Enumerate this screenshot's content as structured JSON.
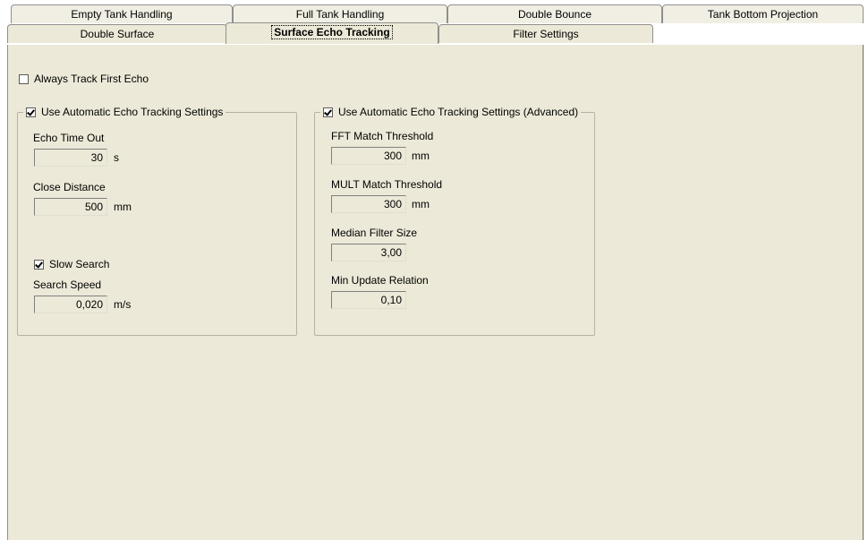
{
  "tabs": {
    "back_row": [
      "Empty Tank Handling",
      "Full Tank Handling",
      "Double Bounce",
      "Tank Bottom Projection"
    ],
    "front_row": [
      "Double Surface",
      "Surface Echo Tracking",
      "Filter Settings"
    ],
    "active": "Surface Echo Tracking"
  },
  "always_track_first_echo": {
    "label": "Always Track First Echo",
    "checked": false
  },
  "basic": {
    "legend": "Use Automatic Echo Tracking Settings",
    "checked": true,
    "echo_time_out": {
      "label": "Echo Time Out",
      "value": "30",
      "unit": "s"
    },
    "close_distance": {
      "label": "Close Distance",
      "value": "500",
      "unit": "mm"
    },
    "slow_search": {
      "label": "Slow Search",
      "checked": true
    },
    "search_speed": {
      "label": "Search Speed",
      "value": "0,020",
      "unit": "m/s"
    }
  },
  "advanced": {
    "legend": "Use Automatic Echo Tracking Settings (Advanced)",
    "checked": true,
    "fft_match_threshold": {
      "label": "FFT Match Threshold",
      "value": "300",
      "unit": "mm"
    },
    "mult_match_threshold": {
      "label": "MULT Match Threshold",
      "value": "300",
      "unit": "mm"
    },
    "median_filter_size": {
      "label": "Median Filter Size",
      "value": "3,00"
    },
    "min_update_relation": {
      "label": "Min Update Relation",
      "value": "0,10"
    }
  }
}
